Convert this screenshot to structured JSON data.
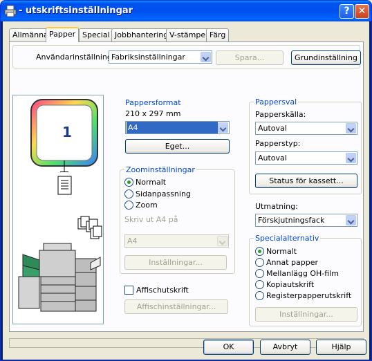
{
  "window": {
    "title": "- utskriftsinställningar",
    "help_label": "?",
    "close_label": "✕",
    "app_icon": "printer-icon"
  },
  "tabs": [
    {
      "label": "Allmänna"
    },
    {
      "label": "Papper"
    },
    {
      "label": "Special"
    },
    {
      "label": "Jobbhantering"
    },
    {
      "label": "V-stämpel"
    },
    {
      "label": "Färg"
    }
  ],
  "user_settings": {
    "label": "Användarinställningar:",
    "value": "Fabriksinställningar",
    "save_label": "Spara...",
    "defaults_label": "Grundinställning"
  },
  "preview": {
    "page_number": "1"
  },
  "paper_format": {
    "group_label": "Pappersformat",
    "size_text": "210 x 297 mm",
    "value": "A4",
    "custom_label": "Eget..."
  },
  "zoom": {
    "group_label": "Zoominställningar",
    "options": [
      "Normalt",
      "Sidanpassning",
      "Zoom"
    ],
    "selected": "Normalt",
    "print_on_label": "Skriv ut A4 på",
    "print_on_value": "A4",
    "settings_label": "Inställningar..."
  },
  "poster": {
    "checkbox_label": "Affischutskrift",
    "checked": false,
    "settings_label": "Affischinställningar..."
  },
  "paper_selection": {
    "group_label": "Pappersval",
    "source_label": "Papperskälla:",
    "source_value": "Autoval",
    "type_label": "Papperstyp:",
    "type_value": "Autoval",
    "cassette_status_label": "Status för kassett..."
  },
  "output": {
    "label": "Utmatning:",
    "value": "Förskjutningsfack"
  },
  "special_options": {
    "group_label": "Specialalternativ",
    "options": [
      "Normalt",
      "Annat papper",
      "Mellanlägg OH-film",
      "Kopiautskrift",
      "Registerpapperutskrift"
    ],
    "selected": "Normalt",
    "settings_label": "Inställningar..."
  },
  "footer": {
    "ok_label": "OK",
    "cancel_label": "Avbryt",
    "help_label": "Hjälp"
  },
  "colors": {
    "titlebar": "#0053EE",
    "tab_highlight": "#FFC83C",
    "group_label": "#0046D5",
    "selection": "#316AC5"
  }
}
